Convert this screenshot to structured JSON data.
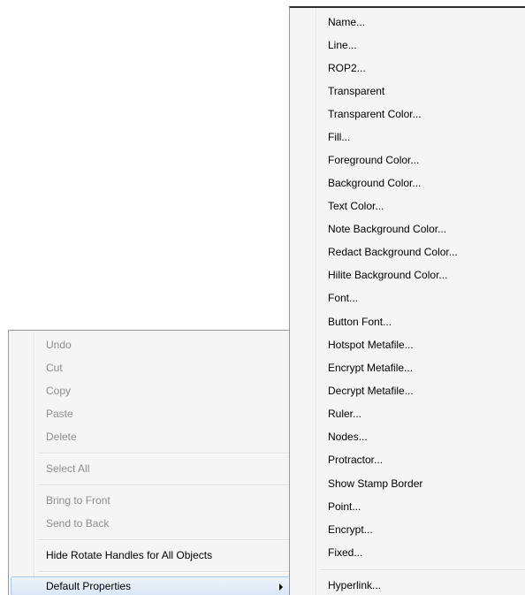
{
  "context_menu": {
    "items": [
      {
        "label": "Undo",
        "enabled": false
      },
      {
        "label": "Cut",
        "enabled": false
      },
      {
        "label": "Copy",
        "enabled": false
      },
      {
        "label": "Paste",
        "enabled": false
      },
      {
        "label": "Delete",
        "enabled": false
      },
      {
        "label": "Select All",
        "enabled": false
      },
      {
        "label": "Bring to Front",
        "enabled": false
      },
      {
        "label": "Send to Back",
        "enabled": false
      },
      {
        "label": "Hide Rotate Handles for All Objects",
        "enabled": true
      },
      {
        "label": "Default Properties",
        "enabled": true,
        "has_submenu": true,
        "highlighted": true
      }
    ]
  },
  "submenu": {
    "items": [
      {
        "label": "Name..."
      },
      {
        "label": "Line..."
      },
      {
        "label": "ROP2..."
      },
      {
        "label": "Transparent"
      },
      {
        "label": "Transparent Color..."
      },
      {
        "label": "Fill..."
      },
      {
        "label": "Foreground Color..."
      },
      {
        "label": "Background Color..."
      },
      {
        "label": "Text Color..."
      },
      {
        "label": "Note Background Color..."
      },
      {
        "label": "Redact Background Color..."
      },
      {
        "label": "Hilite Background Color..."
      },
      {
        "label": "Font..."
      },
      {
        "label": "Button Font..."
      },
      {
        "label": "Hotspot Metafile..."
      },
      {
        "label": "Encrypt Metafile..."
      },
      {
        "label": "Decrypt Metafile..."
      },
      {
        "label": "Ruler..."
      },
      {
        "label": "Nodes..."
      },
      {
        "label": "Protractor..."
      },
      {
        "label": "Show Stamp Border"
      },
      {
        "label": "Point..."
      },
      {
        "label": "Encrypt..."
      },
      {
        "label": "Fixed..."
      },
      {
        "label": "Hyperlink..."
      }
    ]
  },
  "colors": {
    "menu_background": "#f5f5f5",
    "menu_border": "#979797",
    "disabled_text": "#8d8d8d",
    "highlight_border": "#a8c6ee"
  }
}
